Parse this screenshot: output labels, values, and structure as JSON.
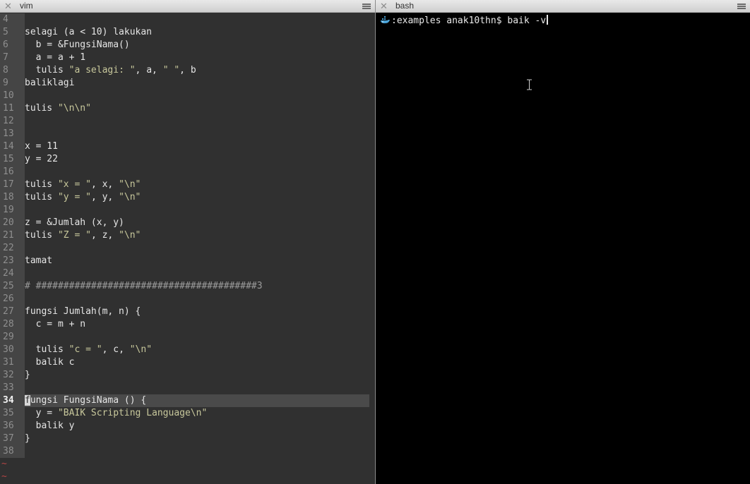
{
  "vim": {
    "tab_title": "vim",
    "lines": [
      {
        "no": "4",
        "segments": []
      },
      {
        "no": "5",
        "segments": [
          {
            "t": "selagi (a < 10) lakukan"
          }
        ]
      },
      {
        "no": "6",
        "segments": [
          {
            "t": "  b = &FungsiNama()"
          }
        ]
      },
      {
        "no": "7",
        "segments": [
          {
            "t": "  a = a + 1"
          }
        ]
      },
      {
        "no": "8",
        "segments": [
          {
            "t": "  tulis "
          },
          {
            "t": "\"a selagi: \"",
            "k": "s"
          },
          {
            "t": ", a, "
          },
          {
            "t": "\" \"",
            "k": "s"
          },
          {
            "t": ", b"
          }
        ]
      },
      {
        "no": "9",
        "segments": [
          {
            "t": "baliklagi"
          }
        ]
      },
      {
        "no": "10",
        "segments": []
      },
      {
        "no": "11",
        "segments": [
          {
            "t": "tulis "
          },
          {
            "t": "\"\\n\\n\"",
            "k": "s"
          }
        ]
      },
      {
        "no": "12",
        "segments": []
      },
      {
        "no": "13",
        "segments": []
      },
      {
        "no": "14",
        "segments": [
          {
            "t": "x = 11"
          }
        ]
      },
      {
        "no": "15",
        "segments": [
          {
            "t": "y = 22"
          }
        ]
      },
      {
        "no": "16",
        "segments": []
      },
      {
        "no": "17",
        "segments": [
          {
            "t": "tulis "
          },
          {
            "t": "\"x = \"",
            "k": "s"
          },
          {
            "t": ", x, "
          },
          {
            "t": "\"\\n\"",
            "k": "s"
          }
        ]
      },
      {
        "no": "18",
        "segments": [
          {
            "t": "tulis "
          },
          {
            "t": "\"y = \"",
            "k": "s"
          },
          {
            "t": ", y, "
          },
          {
            "t": "\"\\n\"",
            "k": "s"
          }
        ]
      },
      {
        "no": "19",
        "segments": []
      },
      {
        "no": "20",
        "segments": [
          {
            "t": "z = &Jumlah (x, y)"
          }
        ]
      },
      {
        "no": "21",
        "segments": [
          {
            "t": "tulis "
          },
          {
            "t": "\"Z = \"",
            "k": "s"
          },
          {
            "t": ", z, "
          },
          {
            "t": "\"\\n\"",
            "k": "s"
          }
        ]
      },
      {
        "no": "22",
        "segments": []
      },
      {
        "no": "23",
        "segments": [
          {
            "t": "tamat"
          }
        ]
      },
      {
        "no": "24",
        "segments": []
      },
      {
        "no": "25",
        "segments": [
          {
            "t": "# ########################################3",
            "k": "c"
          }
        ]
      },
      {
        "no": "26",
        "segments": []
      },
      {
        "no": "27",
        "segments": [
          {
            "t": "fungsi Jumlah(m, n) {"
          }
        ]
      },
      {
        "no": "28",
        "segments": [
          {
            "t": "  c = m + n"
          }
        ]
      },
      {
        "no": "29",
        "segments": []
      },
      {
        "no": "30",
        "segments": [
          {
            "t": "  tulis "
          },
          {
            "t": "\"c = \"",
            "k": "s"
          },
          {
            "t": ", c, "
          },
          {
            "t": "\"\\n\"",
            "k": "s"
          }
        ]
      },
      {
        "no": "31",
        "segments": [
          {
            "t": "  balik c"
          }
        ]
      },
      {
        "no": "32",
        "segments": [
          {
            "t": "}"
          }
        ]
      },
      {
        "no": "33",
        "segments": []
      },
      {
        "no": "34",
        "current": true,
        "segments": [
          {
            "t": "f",
            "k": "cursor"
          },
          {
            "t": "ungsi FungsiNama () {"
          }
        ]
      },
      {
        "no": "35",
        "segments": [
          {
            "t": "  y = "
          },
          {
            "t": "\"BAIK Scripting Language\\n\"",
            "k": "s"
          }
        ]
      },
      {
        "no": "36",
        "segments": [
          {
            "t": "  balik y"
          }
        ]
      },
      {
        "no": "37",
        "segments": [
          {
            "t": "}"
          }
        ]
      },
      {
        "no": "38",
        "segments": []
      }
    ],
    "tildes": [
      "~",
      "~"
    ]
  },
  "bash": {
    "tab_title": "bash",
    "prompt": ":examples anak10thn$ ",
    "command": "baik -v",
    "prompt_icon": "whale-icon"
  },
  "colors": {
    "vim_bg": "#303030",
    "gutter_bg": "#454545",
    "string": "#c8c89c",
    "comment": "#9b9b9b",
    "tilde": "#b64545",
    "terminal_bg": "#000000",
    "whale": "#4aa3d8"
  }
}
